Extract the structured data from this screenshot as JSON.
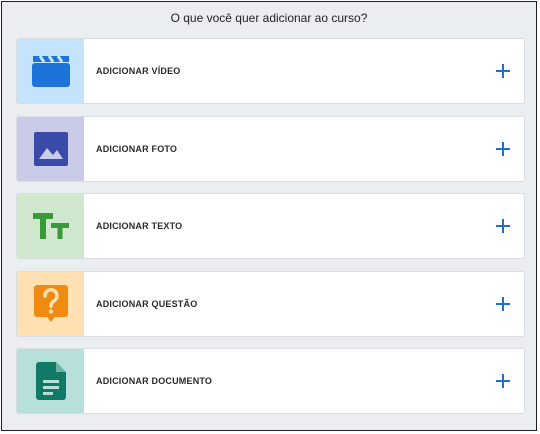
{
  "dialog": {
    "title": "O que você quer adicionar ao curso?"
  },
  "options": [
    {
      "label": "ADICIONAR VÍDEO",
      "icon": "video-clapper-icon",
      "bg": "#c5e3fb",
      "fg": "#1e73d8"
    },
    {
      "label": "ADICIONAR FOTO",
      "icon": "photo-icon",
      "bg": "#c9cbe8",
      "fg": "#3a4aa8"
    },
    {
      "label": "ADICIONAR TEXTO",
      "icon": "text-icon",
      "bg": "#cfe8cd",
      "fg": "#3a9a3a"
    },
    {
      "label": "ADICIONAR QUESTÃO",
      "icon": "question-icon",
      "bg": "#ffe0b3",
      "fg": "#f08a10"
    },
    {
      "label": "ADICIONAR DOCUMENTO",
      "icon": "document-icon",
      "bg": "#b6e0d9",
      "fg": "#107a66"
    }
  ],
  "colors": {
    "accent": "#1e6fd1",
    "panel_bg": "#ebeef1"
  }
}
